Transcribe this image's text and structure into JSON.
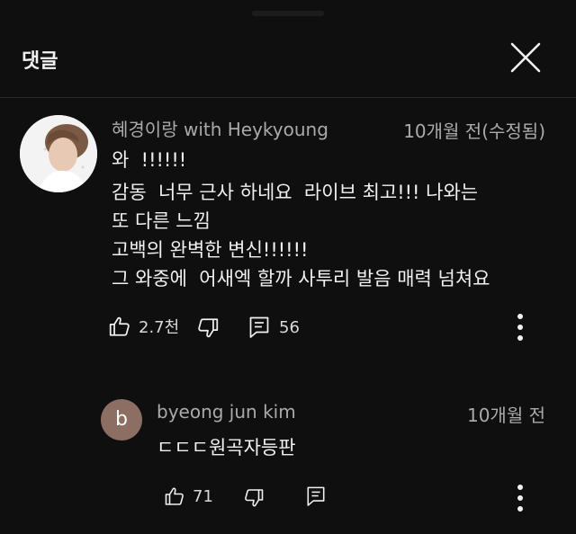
{
  "header": {
    "title": "댓글"
  },
  "comment": {
    "author": "혜경이랑 with Heykyoung",
    "time": "10개월 전(수정됨)",
    "lines": [
      "와  !!!!!!",
      "감동  너무 근사 하네요  라이브 최고!!! 나와는",
      "또 다른 느낌",
      "고백의 완벽한 변신!!!!!!",
      "그 와중에  어새엑 할까 사투리 발음 매력 넘쳐요"
    ],
    "likes": "2.7천",
    "replies": "56"
  },
  "reply": {
    "avatar_letter": "b",
    "author": "byeong jun kim",
    "time": "10개월 전",
    "text": "ㄷㄷㄷ원곡자등판",
    "likes": "71"
  },
  "icons": {
    "close": "close-icon",
    "like": "thumbs-up-icon",
    "dislike": "thumbs-down-icon",
    "reply": "comment-icon",
    "more": "more-vert-icon"
  },
  "colors": {
    "background": "#0f0f0f",
    "text": "#f1f1f1",
    "muted": "#aaaaaa",
    "reply_avatar": "#8d6e63"
  }
}
